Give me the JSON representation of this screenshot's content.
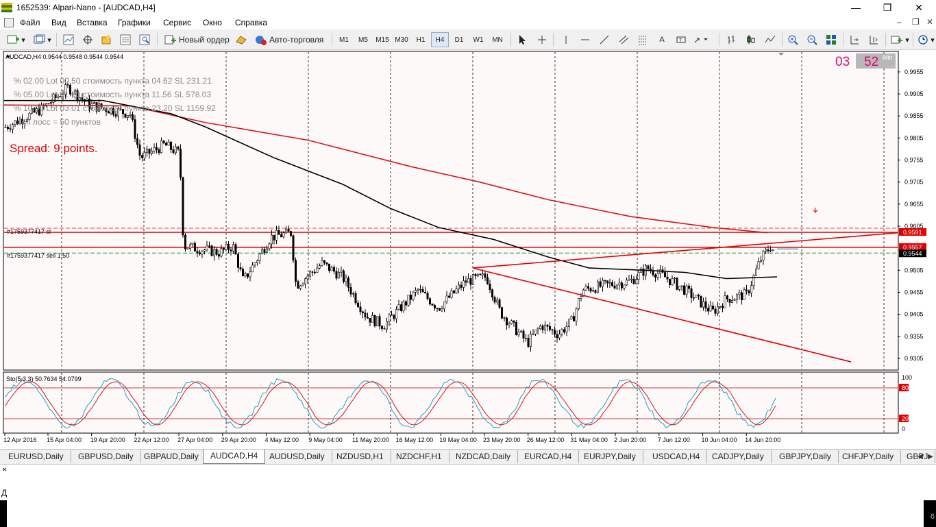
{
  "window": {
    "title": "1652539: Alpari-Nano - [AUDCAD,H4]",
    "minimize": "—",
    "maximize": "❐",
    "close": "✕"
  },
  "menu": {
    "items": [
      "Файл",
      "Вид",
      "Вставка",
      "Графики",
      "Сервис",
      "Окно",
      "Справка"
    ],
    "mdi_minimize": "–",
    "mdi_restore": "❐",
    "mdi_close": "✕"
  },
  "toolbar": {
    "new_order": "Новый ордер",
    "auto_trading": "Авто-торговля",
    "timeframes": [
      "M1",
      "M5",
      "M15",
      "M30",
      "H1",
      "H4",
      "D1",
      "W1",
      "MN"
    ],
    "active_timeframe": "H4"
  },
  "chart": {
    "header": "AUDCAD,H4  0.9544 0.9548 0.9544 0.9544",
    "info_lines": [
      "% 02.00  Lot 00.50  стоимость пункта 04.62  SL 231.21",
      "% 05.00  Lot 01.50  стоимость пункта 11.56  SL 578.03",
      "% 10.00  Lot 03.01  стоимость пункта 23.20  SL 1159.92",
      "стоп лосс = 50 пунктов"
    ],
    "spread": "Spread: 9 points.",
    "timer_min": "03",
    "timer_sec": "52",
    "timer_label": "Min",
    "order_sl_label": "#1759377417 sl",
    "order_sell_label": "#1759377417 sell 1.50",
    "price_axis": [
      "0.9955",
      "0.9905",
      "0.9855",
      "0.9805",
      "0.9755",
      "0.9705",
      "0.9655",
      "0.9605",
      "0.9505",
      "0.9455",
      "0.9405",
      "0.9355",
      "0.9305"
    ],
    "price_ymin": 0.928,
    "price_ymax": 1.0,
    "sl_price": "0.9591",
    "sell_price": "0.9557",
    "current_price": "0.9544",
    "stoch_header": "Sto(5,3,3) 50.7634 54.0799",
    "stoch_axis": [
      "100",
      "80",
      "20",
      "0"
    ],
    "time_axis": [
      "12 Apr 2016",
      "15 Apr 04:00",
      "19 Apr 20:00",
      "22 Apr 12:00",
      "27 Apr 04:00",
      "29 Apr 20:00",
      "4 May 12:00",
      "9 May 04:00",
      "11 May 20:00",
      "16 May 12:00",
      "19 May 04:00",
      "23 May 20:00",
      "26 May 12:00",
      "31 May 04:00",
      "2 Jun 20:00",
      "7 Jun 12:00",
      "10 Jun 04:00",
      "14 Jun 20:00"
    ],
    "colors": {
      "background": "#fdf9f9",
      "bull_candle": "#000000",
      "bear_candle": "#000000",
      "ma_slow": "#d81414",
      "ma_fast": "#000000",
      "sl_line": "#e00000",
      "sell_line": "#e00000",
      "bid_line": "#2a8a2a",
      "stoch_main": "#1aa0c8",
      "stoch_signal": "#d81414",
      "timer": "#e0007a"
    }
  },
  "tabs": {
    "items": [
      "EURUSD,Daily",
      "GBPUSD,Daily",
      "GBPAUD,Daily",
      "AUDCAD,H4",
      "AUDUSD,Daily",
      "NZDUSD,H1",
      "NZDCHF,H1",
      "NZDCAD,Daily",
      "EURCAD,H4",
      "EURJPY,Daily",
      "USDCAD,H4",
      "CADJPY,Daily",
      "GBPJPY,Daily",
      "CHFJPY,Daily",
      "GBPJ"
    ],
    "active": "AUDCAD,H4"
  },
  "bottom": {
    "close": "×",
    "letter": "Д",
    "page": "6"
  }
}
